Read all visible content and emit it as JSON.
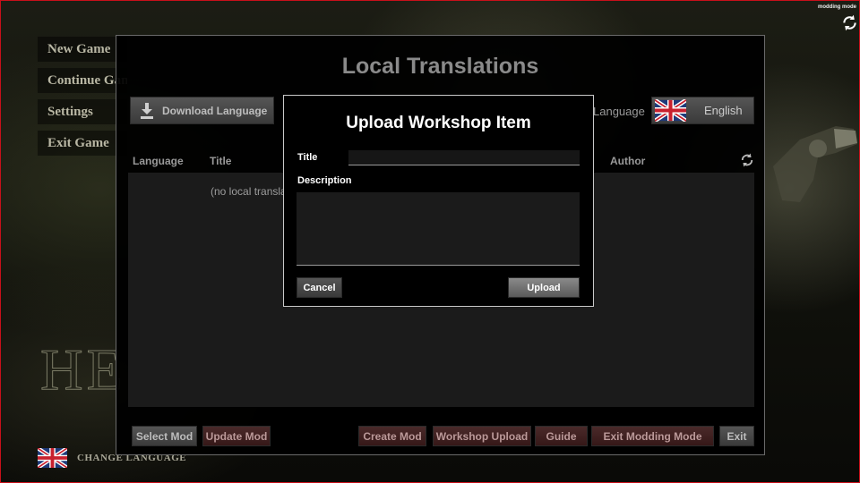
{
  "background_menu": {
    "items": [
      "New Game",
      "Continue Game",
      "Settings",
      "Exit Game"
    ],
    "logo_text": "HE",
    "language_label": "CHANGE LANGUAGE"
  },
  "modding_mode_label": "modding mode",
  "local_translations": {
    "title": "Local Translations",
    "download_label": "Download Language",
    "language_label": "Language",
    "selected_language": "English",
    "columns": [
      "Language",
      "Title",
      "Author"
    ],
    "empty_message": "(no local translations)"
  },
  "upload_dialog": {
    "title": "Upload Workshop Item",
    "title_label": "Title",
    "title_value": "",
    "description_label": "Description",
    "description_value": "",
    "cancel_label": "Cancel",
    "upload_label": "Upload"
  },
  "bottom_bar": {
    "select_mod": "Select Mod",
    "update_mod": "Update Mod",
    "create_mod": "Create Mod",
    "workshop_upload": "Workshop Upload",
    "guide": "Guide",
    "exit_modding_mode": "Exit Modding Mode",
    "exit": "Exit"
  },
  "colors": {
    "frame_border": "#c8101a",
    "button_gray": "#4a4a4a",
    "button_red": "#3d1f1f"
  },
  "icons": {
    "download": "download-icon",
    "refresh": "refresh-icon",
    "modding_mode": "sync-icon",
    "flag": "uk-flag-icon"
  }
}
